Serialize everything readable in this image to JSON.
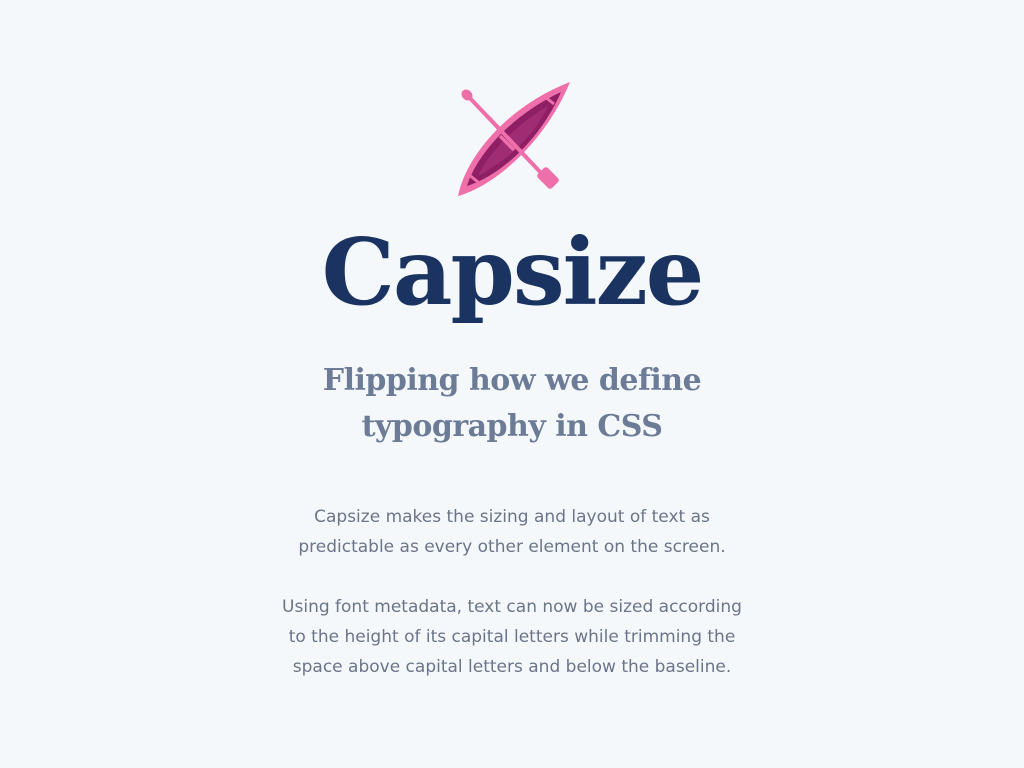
{
  "logo": {
    "icon": "kayak-icon"
  },
  "title": "Capsize",
  "tagline": {
    "line1": "Flipping how we define",
    "line2": "typography in CSS"
  },
  "description": {
    "paragraph1": [
      "Capsize makes the sizing and layout of text as",
      "predictable as every other element on the screen."
    ],
    "paragraph2": [
      "Using font metadata, text can now be sized according",
      "to the height of its capital letters while trimming the",
      "space above capital letters and below the baseline."
    ]
  },
  "colors": {
    "background": "#f5f8fb",
    "title": "#1a3361",
    "tagline": "#6d7c96",
    "body_text": "#6b7589",
    "kayak_pink": "#ee6fa9",
    "kayak_hull": "#8e1f64"
  }
}
